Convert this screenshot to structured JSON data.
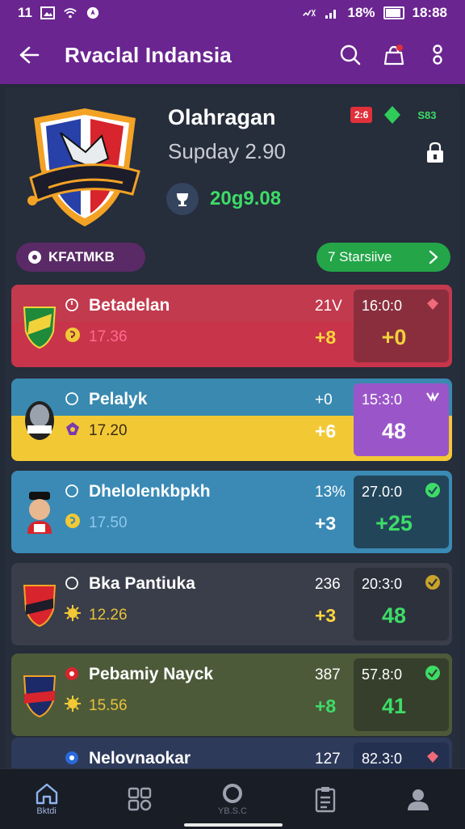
{
  "status_bar": {
    "time": "11",
    "battery_text": "18%",
    "clock": "18:88"
  },
  "app_bar": {
    "title": "Rvaclal Indansia"
  },
  "header": {
    "team_name": "Olahragan",
    "subtitle": "Supday 2.90",
    "score": "20g9.08",
    "live_badge": "2:6",
    "points": "S83"
  },
  "chips": {
    "left_label": "KFATMKB",
    "right_label": "7 Starsiive"
  },
  "matches": [
    {
      "name": "Betadelan",
      "odds": "17.36",
      "value1": "21V",
      "value2": "+8",
      "time": "16:0:0",
      "big": "+0",
      "colors": {
        "top": "#c23a4e",
        "bottom": "#c8344a",
        "box": "#8a2e3e",
        "odds": "#ff6b8f",
        "mid2": "#ffd53d",
        "big": "#f1d23a"
      }
    },
    {
      "name": "Pelalyk",
      "odds": "17.20",
      "value1": "+0",
      "value2": "+6",
      "time": "15:3:0",
      "big": "48",
      "colors": {
        "top": "#3a89b0",
        "bottom": "#f2c935",
        "box": "#9a56c9",
        "odds": "#3a2a18",
        "mid2": "#ffffff",
        "big": "#ffffff"
      }
    },
    {
      "name": "Dhelolenkbpkh",
      "odds": "17.50",
      "value1": "13%",
      "value2": "+3",
      "time": "27.0:0",
      "big": "+25",
      "colors": {
        "top": "#3a8ab5",
        "bottom": "#3a8ab5",
        "box": "#23455a",
        "odds": "#8ec7f0",
        "mid2": "#ffffff",
        "big": "#3ddc67"
      }
    },
    {
      "name": "Bka Pantiuka",
      "odds": "12.26",
      "value1": "236",
      "value2": "+3",
      "time": "20:3:0",
      "big": "48",
      "colors": {
        "top": "#3a3e4a",
        "bottom": "#3a3e4a",
        "box": "#2c313c",
        "odds": "#e6c23a",
        "mid2": "#ffd53d",
        "big": "#3ddc67"
      }
    },
    {
      "name": "Pebamiy Nayck",
      "odds": "15.56",
      "value1": "387",
      "value2": "+8",
      "time": "57.8:0",
      "big": "41",
      "colors": {
        "top": "#4d5a3a",
        "bottom": "#4d5a3a",
        "box": "#363f2c",
        "odds": "#e6c23a",
        "mid2": "#3ddc67",
        "big": "#3ddc67"
      }
    },
    {
      "name": "Nelovnaokar",
      "odds": "",
      "value1": "127",
      "value2": "",
      "time": "82.3:0",
      "big": "",
      "colors": {
        "top": "#2d3a5a",
        "bottom": "#2d3a5a",
        "box": "#243050",
        "odds": "#ffffff",
        "mid2": "#ffffff",
        "big": "#ffffff"
      }
    }
  ],
  "bottom_nav": {
    "home_label": "Bktdi",
    "middle_label": "YB.S.C"
  }
}
